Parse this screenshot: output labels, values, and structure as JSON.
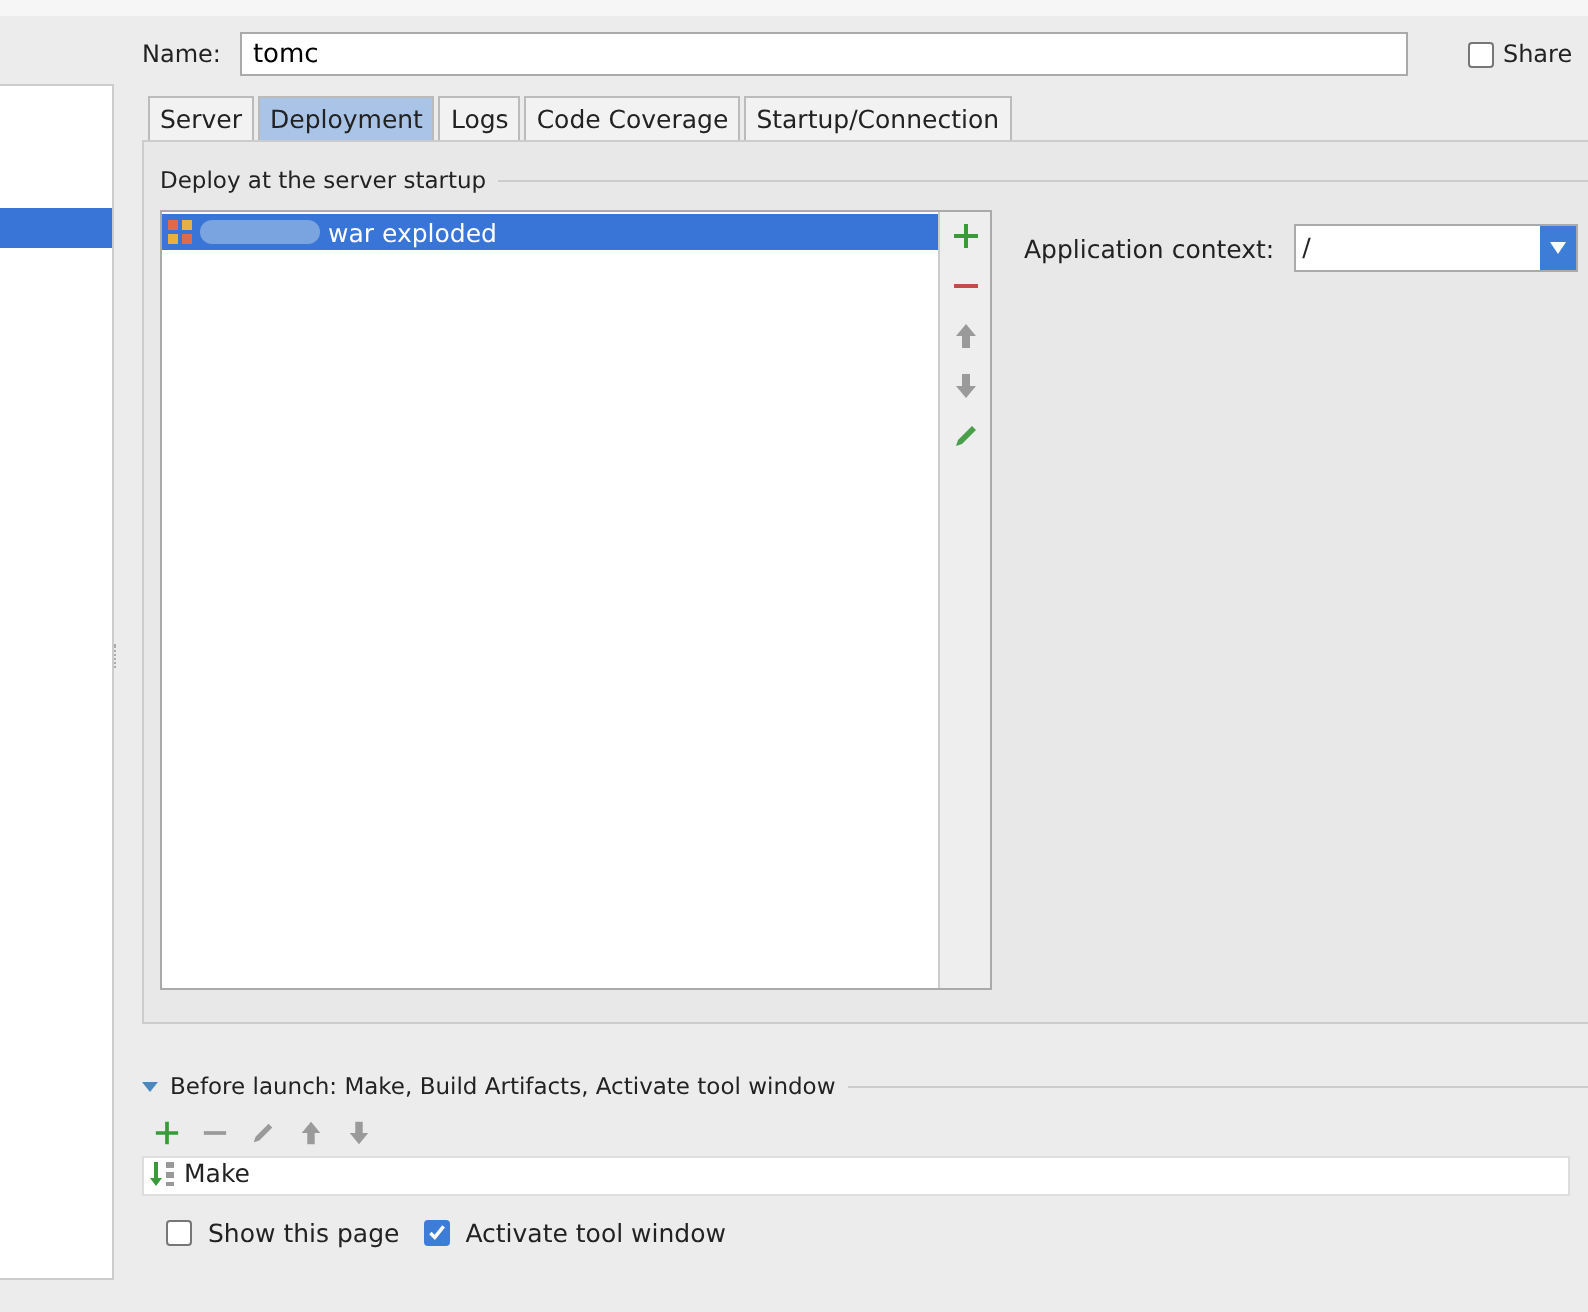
{
  "name_field": {
    "label": "Name:",
    "value": "tomc"
  },
  "share": {
    "label": "Share",
    "checked": false
  },
  "sidebar": {
    "items": [
      {
        "selected": false
      },
      {
        "selected": true
      },
      {
        "selected": false
      }
    ]
  },
  "tabs": [
    {
      "label": "Server",
      "selected": false
    },
    {
      "label": "Deployment",
      "selected": true
    },
    {
      "label": "Logs",
      "selected": false
    },
    {
      "label": "Code Coverage",
      "selected": false
    },
    {
      "label": "Startup/Connection",
      "selected": false
    }
  ],
  "deploy": {
    "title": "Deploy at the server startup",
    "items": [
      {
        "label": "war exploded",
        "selected": true
      }
    ],
    "tools": [
      {
        "kind": "add",
        "disabled": false
      },
      {
        "kind": "remove",
        "disabled": false
      },
      {
        "kind": "up",
        "disabled": true
      },
      {
        "kind": "down",
        "disabled": true
      },
      {
        "kind": "edit",
        "disabled": false
      }
    ]
  },
  "app_context": {
    "label": "Application context:",
    "value": "/"
  },
  "before_launch": {
    "title": "Before launch: Make, Build Artifacts, Activate tool window",
    "expanded": true,
    "tools": [
      {
        "kind": "add",
        "disabled": false
      },
      {
        "kind": "remove",
        "disabled": true
      },
      {
        "kind": "edit",
        "disabled": true
      },
      {
        "kind": "up",
        "disabled": true
      },
      {
        "kind": "down",
        "disabled": true
      }
    ],
    "tasks": [
      {
        "label": "Make"
      }
    ]
  },
  "options": [
    {
      "label": "Show this page",
      "checked": false
    },
    {
      "label": "Activate tool window",
      "checked": true
    }
  ]
}
